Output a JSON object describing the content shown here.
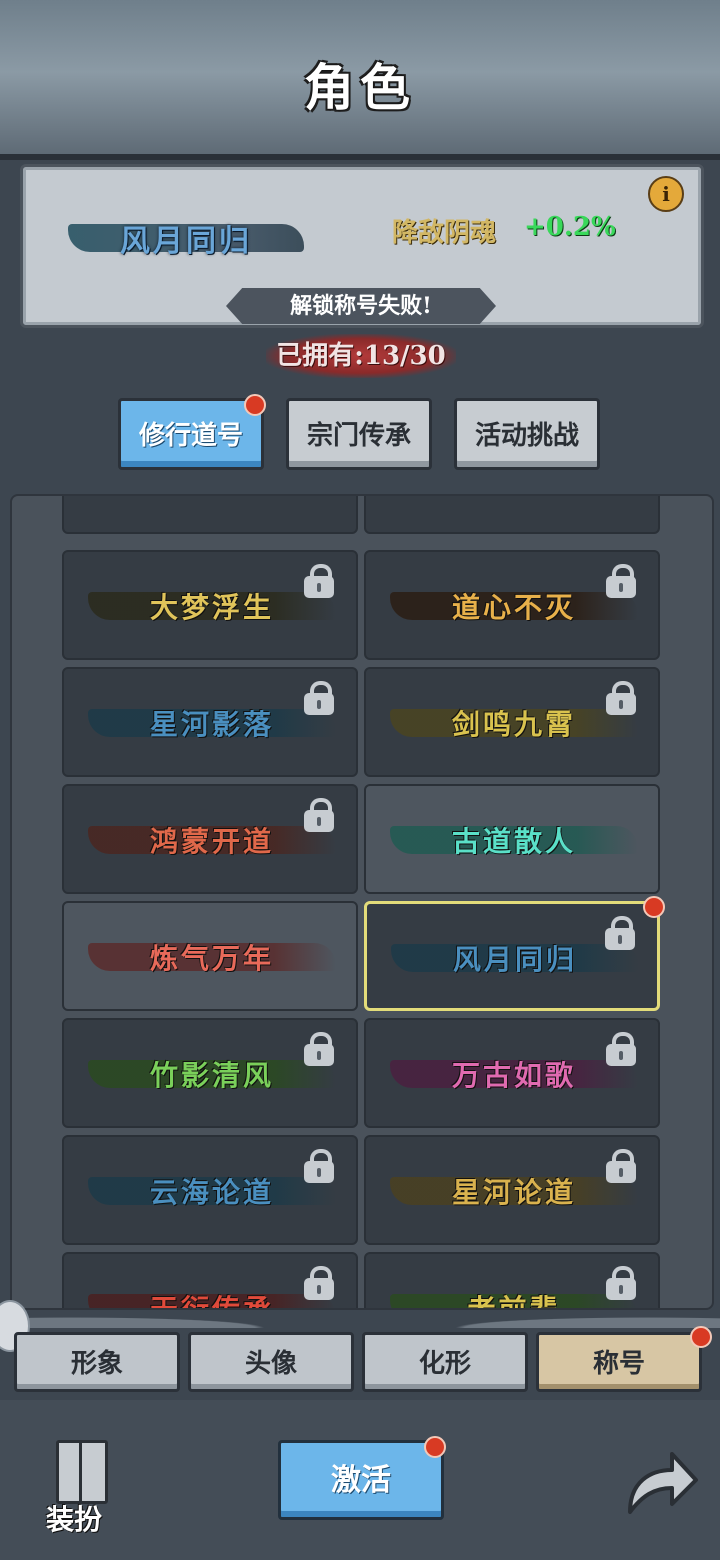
{
  "page_title": "角色",
  "equipped": {
    "title": "风月同归",
    "bonus_label": "降敌阴魂",
    "bonus_value": "+0.2%",
    "info_icon": "info-icon",
    "colors": {
      "ribbon": "#2f5a6a",
      "text": "#6aa6d8"
    }
  },
  "message": "解锁称号失败!",
  "owned_count": "已拥有:13/30",
  "category_tabs": [
    {
      "label": "修行道号",
      "active": true,
      "badge": true
    },
    {
      "label": "宗门传承",
      "active": false,
      "badge": false
    },
    {
      "label": "活动挑战",
      "active": false,
      "badge": false
    }
  ],
  "titles": [
    {
      "name": "大梦浮生",
      "locked": true,
      "color": "#e0c45a",
      "ribbon": "#2a2a1c"
    },
    {
      "name": "道心不灭",
      "locked": true,
      "color": "#e8b04a",
      "ribbon": "#2b1e14"
    },
    {
      "name": "星河影落",
      "locked": true,
      "color": "#4a8fbf",
      "ribbon": "#1c3a48"
    },
    {
      "name": "剑鸣九霄",
      "locked": true,
      "color": "#d9c24e",
      "ribbon": "#4a4420"
    },
    {
      "name": "鸿蒙开道",
      "locked": true,
      "color": "#e0684a",
      "ribbon": "#4a2620"
    },
    {
      "name": "古道散人",
      "locked": false,
      "color": "#5ae0c8",
      "ribbon": "#205a52"
    },
    {
      "name": "炼气万年",
      "locked": false,
      "color": "#e86a5a",
      "ribbon": "#5a2c2c"
    },
    {
      "name": "风月同归",
      "locked": true,
      "selected": true,
      "badge": true,
      "color": "#4a8fbf",
      "ribbon": "#1c3a48"
    },
    {
      "name": "竹影清风",
      "locked": true,
      "color": "#7ad05a",
      "ribbon": "#2a4a20"
    },
    {
      "name": "万古如歌",
      "locked": true,
      "color": "#e06ab0",
      "ribbon": "#4a2040"
    },
    {
      "name": "云海论道",
      "locked": true,
      "color": "#4a8fbf",
      "ribbon": "#1c3a48"
    },
    {
      "name": "星河论道",
      "locked": true,
      "color": "#d9b24e",
      "ribbon": "#4a4020"
    },
    {
      "name": "天衍传承",
      "locked": true,
      "color": "#e04a3a",
      "ribbon": "#4a2020"
    },
    {
      "name": "老前辈",
      "locked": true,
      "color": "#d9c24e",
      "ribbon": "#2a4a20"
    }
  ],
  "bottom_tabs": [
    {
      "label": "形象",
      "active": false
    },
    {
      "label": "头像",
      "active": false
    },
    {
      "label": "化形",
      "active": false
    },
    {
      "label": "称号",
      "active": true,
      "badge": true
    }
  ],
  "footer": {
    "wardrobe_label": "装扮",
    "activate_label": "激活",
    "back_icon": "back-arrow-icon"
  }
}
